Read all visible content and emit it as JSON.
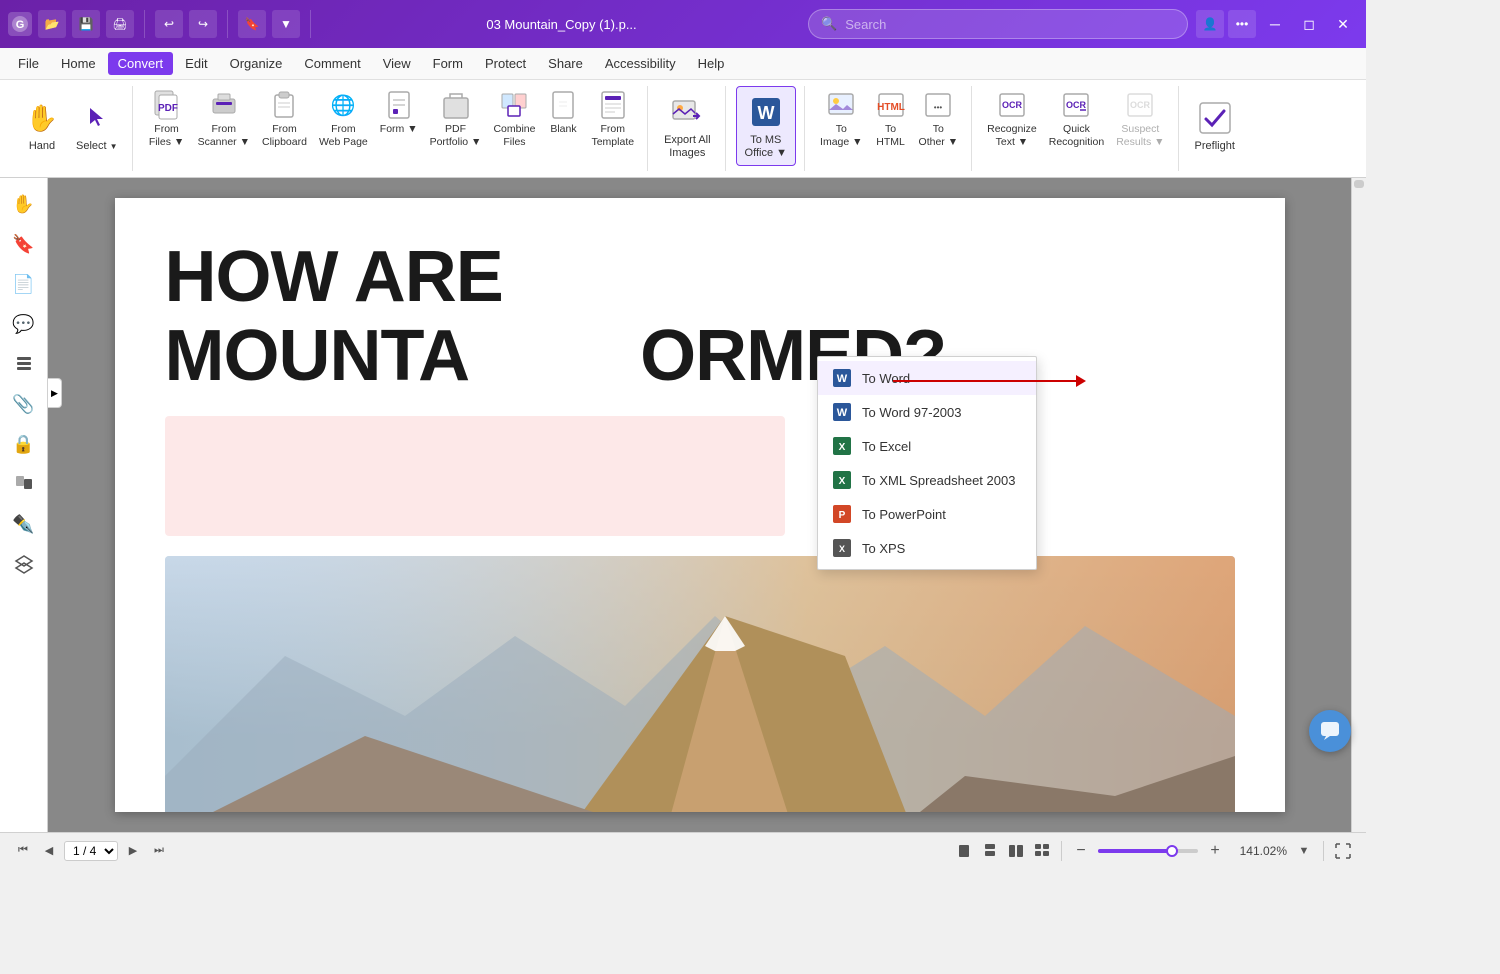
{
  "titlebar": {
    "app_icon": "G",
    "buttons": [
      "open",
      "save",
      "print",
      "undo",
      "redo",
      "stamp",
      "arrow"
    ],
    "filename": "03 Mountain_Copy (1).p...",
    "search_placeholder": "Search",
    "user_icon": "👤",
    "window_controls": [
      "minimize",
      "restore",
      "close"
    ]
  },
  "menubar": {
    "items": [
      "File",
      "Home",
      "Convert",
      "Edit",
      "Organize",
      "Comment",
      "View",
      "Form",
      "Protect",
      "Share",
      "Accessibility",
      "Help"
    ],
    "active": "Convert"
  },
  "ribbon": {
    "groups": [
      {
        "buttons": [
          {
            "id": "hand",
            "icon": "✋",
            "label": "Hand"
          },
          {
            "id": "select",
            "icon": "↖",
            "label": "Select",
            "has_arrow": true
          }
        ]
      },
      {
        "buttons": [
          {
            "id": "from-files",
            "icon": "📄",
            "label": "From\nFiles",
            "has_arrow": true
          },
          {
            "id": "from-scanner",
            "icon": "🖨",
            "label": "From\nScanner",
            "has_arrow": true
          },
          {
            "id": "from-clipboard",
            "icon": "📋",
            "label": "From\nClipboard"
          },
          {
            "id": "from-webpage",
            "icon": "🌐",
            "label": "From\nWeb Page"
          },
          {
            "id": "form",
            "icon": "📝",
            "label": "Form",
            "has_arrow": true
          },
          {
            "id": "pdf-portfolio",
            "icon": "🗂",
            "label": "PDF\nPortfolio",
            "has_arrow": true
          },
          {
            "id": "combine-files",
            "icon": "🔗",
            "label": "Combine\nFiles"
          },
          {
            "id": "blank",
            "icon": "📄",
            "label": "Blank"
          },
          {
            "id": "from-template",
            "icon": "📋",
            "label": "From\nTemplate"
          }
        ]
      },
      {
        "buttons": [
          {
            "id": "export-all-images",
            "icon": "🖼",
            "label": "Export All\nImages"
          }
        ]
      },
      {
        "buttons": [
          {
            "id": "to-ms-office",
            "icon": "W",
            "label": "To MS\nOffice",
            "has_arrow": true,
            "active": true
          }
        ]
      },
      {
        "buttons": [
          {
            "id": "to-image",
            "icon": "🖼",
            "label": "To\nImage",
            "has_arrow": true
          },
          {
            "id": "to-html",
            "icon": "H",
            "label": "To\nHTML"
          },
          {
            "id": "to-other",
            "icon": "📄",
            "label": "To\nOther",
            "has_arrow": true
          }
        ]
      },
      {
        "buttons": [
          {
            "id": "recognize-text",
            "icon": "OCR",
            "label": "Recognize\nText",
            "has_arrow": true
          },
          {
            "id": "quick-recognition",
            "icon": "OCR",
            "label": "Quick\nRecognition"
          },
          {
            "id": "suspect-results",
            "icon": "OCR",
            "label": "Suspect\nResults",
            "disabled": true
          }
        ]
      },
      {
        "buttons": [
          {
            "id": "preflight",
            "icon": "✓",
            "label": "Preflight"
          }
        ]
      }
    ]
  },
  "sidebar": {
    "icons": [
      "hand",
      "bookmark",
      "page",
      "comment",
      "layers",
      "paperclip",
      "lock",
      "pages",
      "arrow-right",
      "signature",
      "layers2"
    ]
  },
  "document": {
    "title": "HOW ARE MOUNTA          ORMED?",
    "page": "1 / 4",
    "zoom": "141.02%"
  },
  "dropdown": {
    "items": [
      {
        "id": "to-word",
        "icon": "W",
        "label": "To Word",
        "highlighted": true
      },
      {
        "id": "to-word-97",
        "icon": "W",
        "label": "To Word 97-2003"
      },
      {
        "id": "to-excel",
        "icon": "X",
        "label": "To Excel"
      },
      {
        "id": "to-xml",
        "icon": "X",
        "label": "To XML Spreadsheet 2003"
      },
      {
        "id": "to-powerpoint",
        "icon": "P",
        "label": "To PowerPoint"
      },
      {
        "id": "to-xps",
        "icon": "X",
        "label": "To XPS"
      }
    ]
  },
  "statusbar": {
    "page_label": "1 / 4",
    "zoom_label": "141.02%",
    "view_modes": [
      "single",
      "dual",
      "grid",
      "facing"
    ]
  }
}
